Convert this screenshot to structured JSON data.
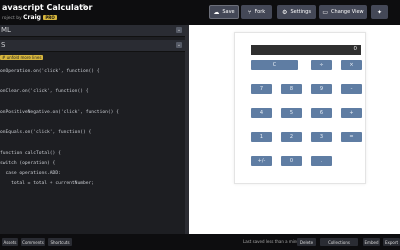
{
  "header": {
    "title": "avascript Calculator",
    "byline_prefix": "roject by",
    "author": "Craig",
    "pro_badge": "PRO",
    "buttons": {
      "save": "Save",
      "fork": "Fork",
      "settings": "Settings",
      "change_view": "Change View"
    }
  },
  "editor": {
    "html_panel_label": "ML",
    "css_panel_label": "S",
    "fold_tag": "# unfold more lines",
    "code_lines": [
      {
        "kw": "",
        "text": "onOperation.on('click', function() {"
      },
      {
        "kw": "",
        "text": ""
      },
      {
        "kw": "",
        "text": "onClear.on('click', function() {"
      },
      {
        "kw": "",
        "text": ""
      },
      {
        "kw": "",
        "text": "onPositiveNegative.on('click', function() {"
      },
      {
        "kw": "",
        "text": ""
      },
      {
        "kw": "",
        "text": "onEquals.on('click', function() {"
      },
      {
        "kw": "",
        "text": ""
      },
      {
        "kw": "",
        "text": "function calcTotal() {"
      },
      {
        "kw": "",
        "text": "switch (operation) {"
      },
      {
        "kw": "",
        "text": "  case operations.ADD:"
      },
      {
        "kw": "",
        "text": "    total = total + currentNumber;"
      }
    ]
  },
  "preview": {
    "display_value": "0",
    "keys": [
      "C",
      "÷",
      "×",
      "7",
      "8",
      "9",
      "-",
      "4",
      "5",
      "6",
      "+",
      "1",
      "2",
      "3",
      "=",
      "+/-",
      "0",
      "."
    ]
  },
  "footer": {
    "assets": "Assets",
    "comments": "Comments",
    "shortcuts": "Shortcuts",
    "last_saved": "Last saved less than a minute ago",
    "delete": "Delete",
    "collections": "Collections",
    "embed": "Embed",
    "export": "Export"
  },
  "colors": {
    "key_blue": "#5f7da3",
    "pro_gold": "#d7b63d",
    "header_bg": "#0d0d0f"
  }
}
